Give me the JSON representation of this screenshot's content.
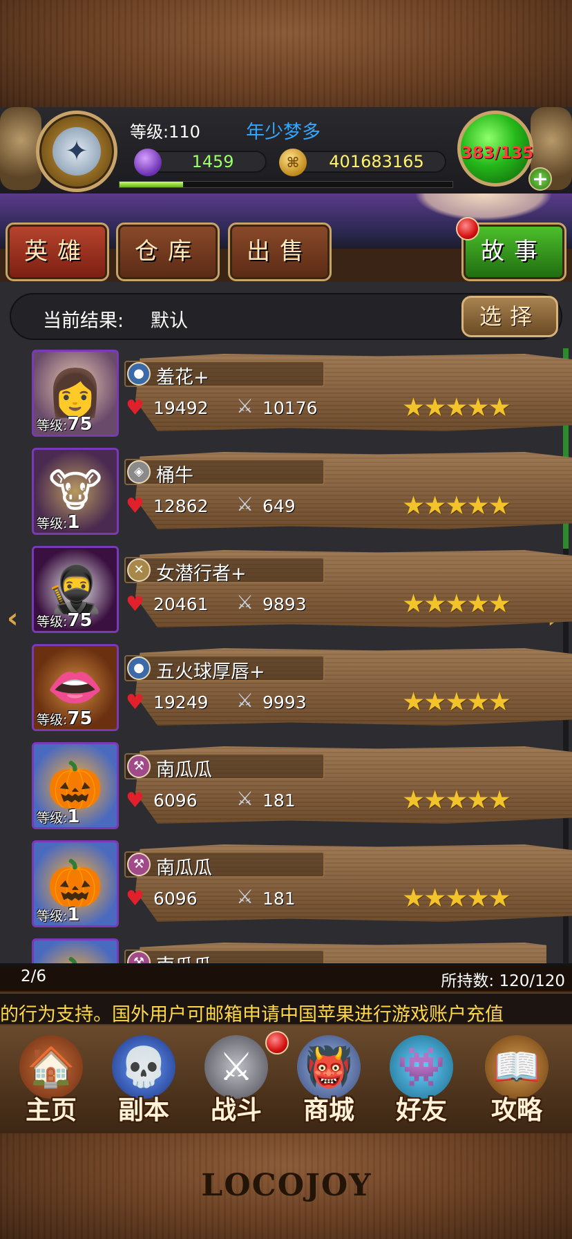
{
  "colors": {
    "player_name": "#33a6ff",
    "gems": "#9dff6a",
    "gold": "#fff36a",
    "hp_orb_text": "#ff3d3d",
    "ticker": "#ffd84a",
    "star": "#f2c32a"
  },
  "player": {
    "level_label": "等级:110",
    "name": "年少梦多",
    "gems": "1459",
    "gold": "401683165",
    "stamina": "383/135",
    "xp_progress": 0.19,
    "emblem_icon": "rank-emblem-icon",
    "add_icon": "plus-icon"
  },
  "tabs": {
    "heroes": "英雄",
    "warehouse": "仓库",
    "sell": "出售",
    "story": "故事"
  },
  "filter": {
    "label": "当前结果:",
    "value": "默认",
    "select_button": "选择"
  },
  "heroes": [
    {
      "name": "羞花+",
      "level_label": "等级:",
      "level": "75",
      "hp": "19492",
      "attack": "10176",
      "stars": 5,
      "portrait": "female-warrior-portrait",
      "class_icon": "mage-class-icon"
    },
    {
      "name": "桶牛",
      "level_label": "等级:",
      "level": "1",
      "hp": "12862",
      "attack": "649",
      "stars": 5,
      "portrait": "horned-bull-portrait",
      "class_icon": "shield-class-icon"
    },
    {
      "name": "女潜行者+",
      "level_label": "等级:",
      "level": "75",
      "hp": "20461",
      "attack": "9893",
      "stars": 5,
      "portrait": "masked-assassin-portrait",
      "class_icon": "rogue-class-icon"
    },
    {
      "name": "五火球厚唇+",
      "level_label": "等级:",
      "level": "75",
      "hp": "19249",
      "attack": "9993",
      "stars": 5,
      "portrait": "big-lips-portrait",
      "class_icon": "mage-class-icon"
    },
    {
      "name": "南瓜瓜",
      "level_label": "等级:",
      "level": "1",
      "hp": "6096",
      "attack": "181",
      "stars": 5,
      "portrait": "pumpkin-portrait",
      "class_icon": "hammer-class-icon"
    },
    {
      "name": "南瓜瓜",
      "level_label": "等级:",
      "level": "1",
      "hp": "6096",
      "attack": "181",
      "stars": 5,
      "portrait": "pumpkin-portrait",
      "class_icon": "hammer-class-icon"
    },
    {
      "name": "南瓜瓜",
      "portrait": "pumpkin-portrait",
      "class_icon": "hammer-class-icon"
    }
  ],
  "pager": {
    "page": "2/6",
    "holding": "所持数: 120/120"
  },
  "ticker": "的行为支持。国外用户可邮箱申请中国苹果进行游戏账户充值",
  "nav": [
    {
      "label": "主页",
      "icon": "house-icon"
    },
    {
      "label": "副本",
      "icon": "skull-icon"
    },
    {
      "label": "战斗",
      "icon": "swords-icon"
    },
    {
      "label": "商城",
      "icon": "shop-monster-icon"
    },
    {
      "label": "好友",
      "icon": "friends-icon"
    },
    {
      "label": "攻略",
      "icon": "guide-book-icon"
    }
  ],
  "logo": "LOCOJOY"
}
